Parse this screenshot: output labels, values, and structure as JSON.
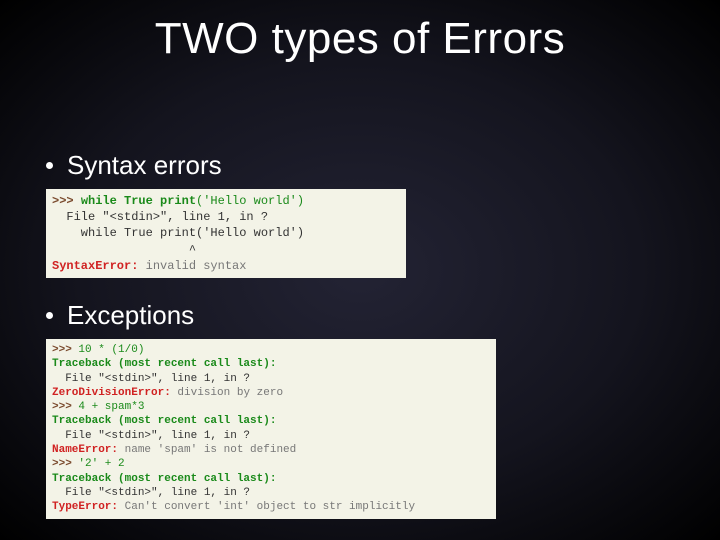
{
  "title": "TWO types of Errors",
  "bullets": {
    "syntax": "Syntax errors",
    "exceptions": "Exceptions"
  },
  "code1": {
    "l1_prompt": ">>> ",
    "l1_kw": "while True print",
    "l1_rest": "('Hello world')",
    "l2": "  File \"<stdin>\", line 1, in ?",
    "l3": "    while True print('Hello world')",
    "l4": "                   ^",
    "l5_err": "SyntaxError:",
    "l5_msg": " invalid syntax"
  },
  "code2": {
    "a1_prompt": ">>> ",
    "a1_body": "10 * (1/0)",
    "a2_trace": "Traceback (most recent call last):",
    "a3": "  File \"<stdin>\", line 1, in ?",
    "a4_err": "ZeroDivisionError:",
    "a4_msg": " division by zero",
    "b1_prompt": ">>> ",
    "b1_body": "4 + spam*3",
    "b2_trace": "Traceback (most recent call last):",
    "b3": "  File \"<stdin>\", line 1, in ?",
    "b4_err": "NameError:",
    "b4_msg": " name 'spam' is not defined",
    "c1_prompt": ">>> ",
    "c1_body": "'2' + 2",
    "c2_trace": "Traceback (most recent call last):",
    "c3": "  File \"<stdin>\", line 1, in ?",
    "c4_err": "TypeError:",
    "c4_msg": " Can't convert 'int' object to str implicitly"
  }
}
